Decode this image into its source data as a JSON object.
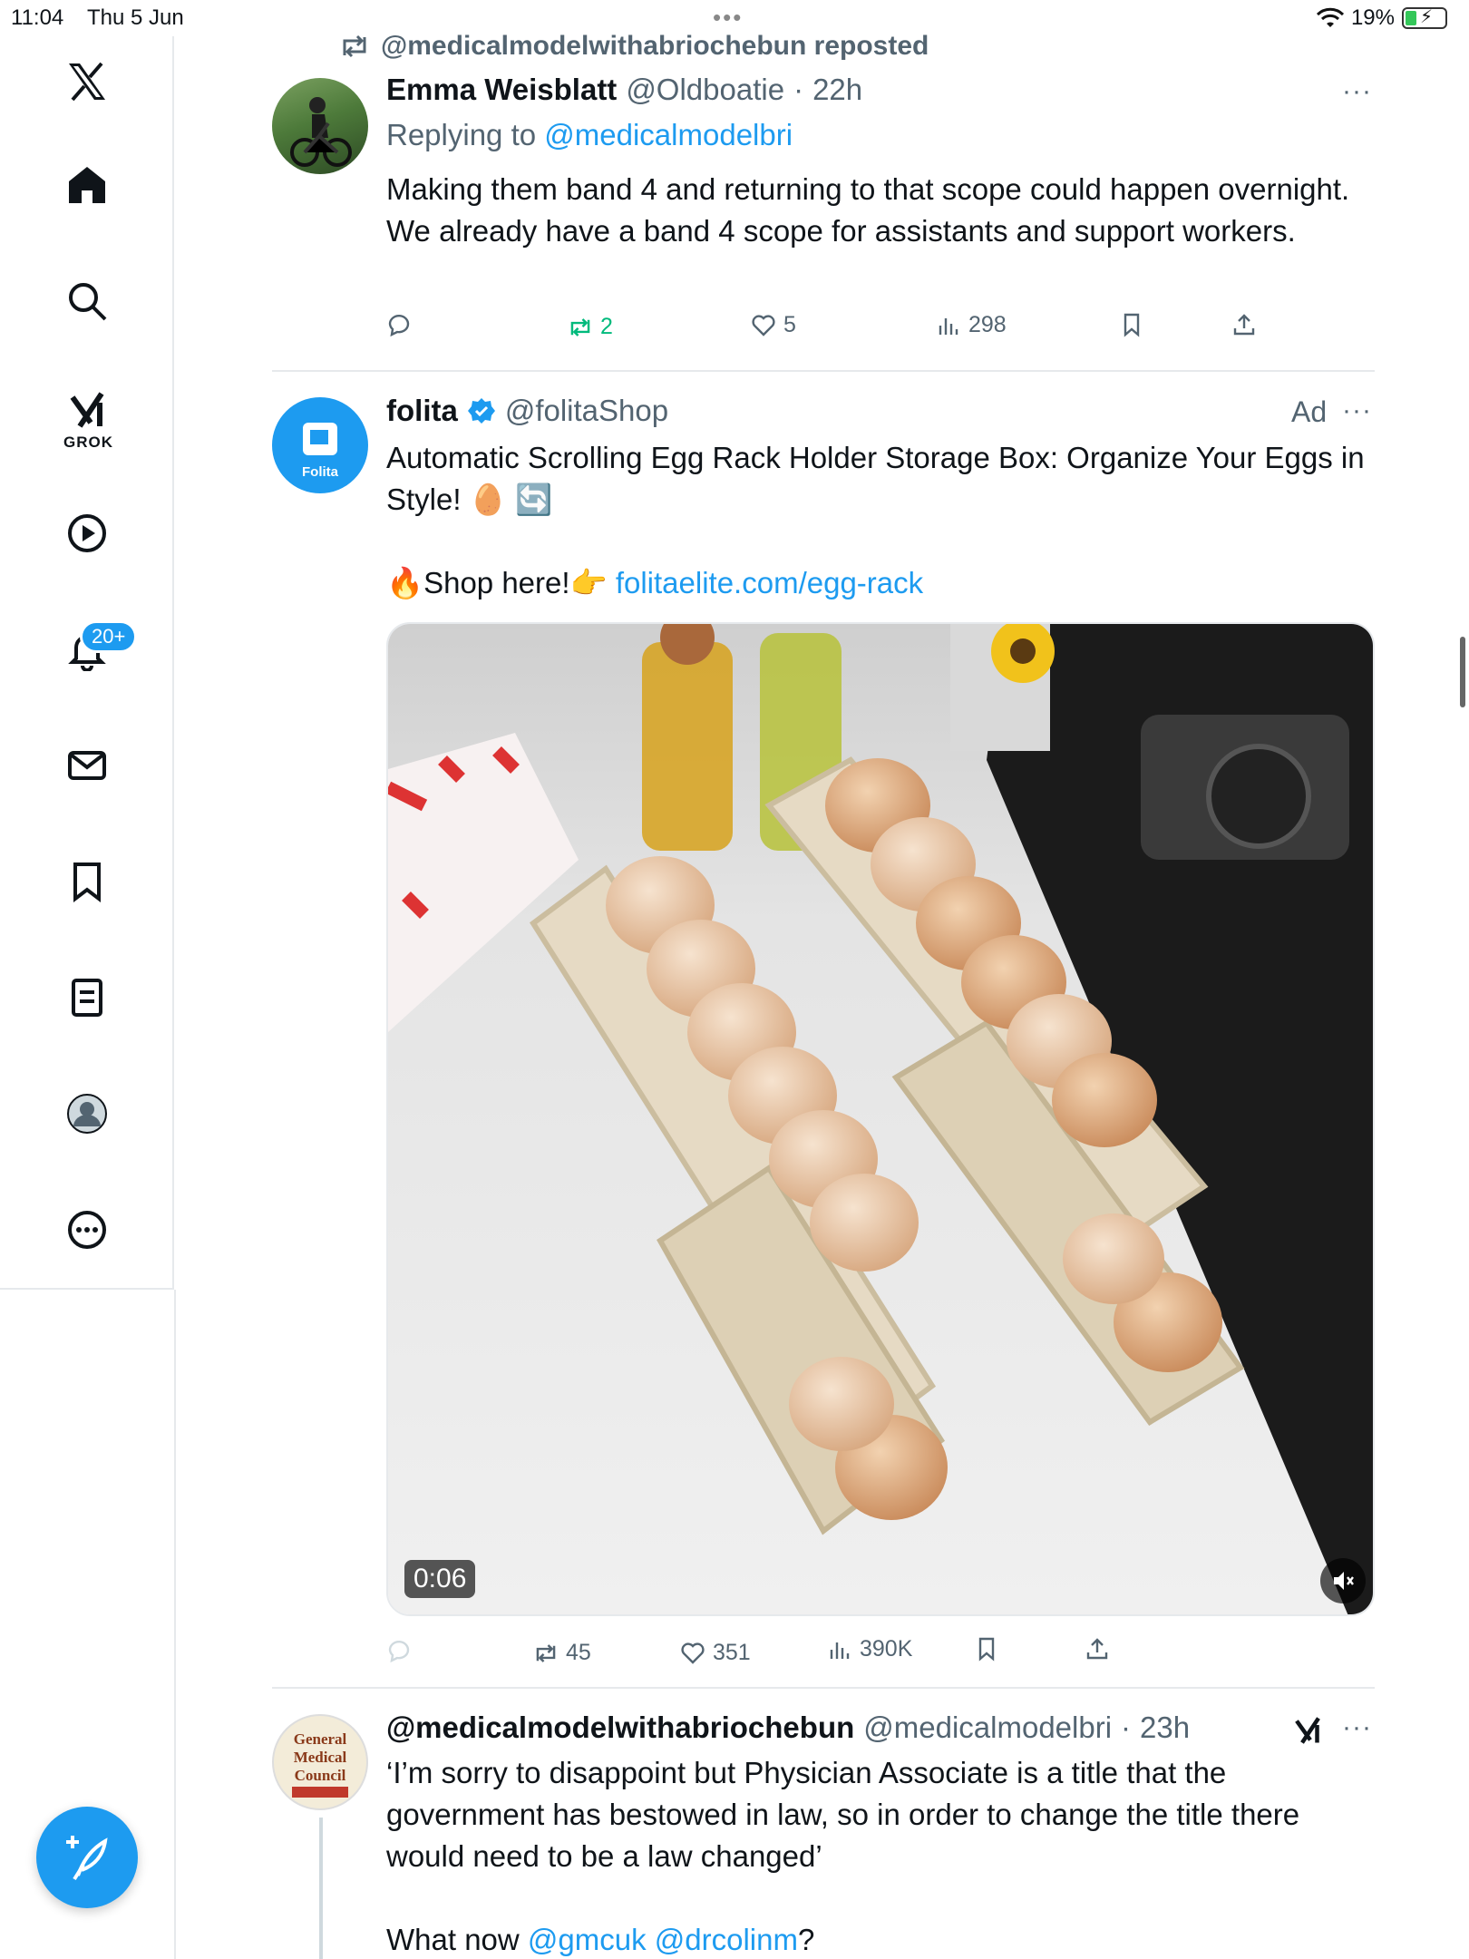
{
  "status_bar": {
    "time": "11:04",
    "date": "Thu 5 Jun",
    "battery": "19%"
  },
  "sidebar": {
    "items": [
      {
        "name": "x-logo"
      },
      {
        "name": "home"
      },
      {
        "name": "search"
      },
      {
        "name": "grok",
        "label": "GROK"
      },
      {
        "name": "video"
      },
      {
        "name": "notifications",
        "badge": "20+"
      },
      {
        "name": "messages"
      },
      {
        "name": "bookmarks"
      },
      {
        "name": "lists"
      },
      {
        "name": "profile"
      },
      {
        "name": "more"
      }
    ]
  },
  "posts": [
    {
      "repost_banner": "@medicalmodelwithabriochebun reposted",
      "name": "Emma Weisblatt",
      "handle": "@Oldboatie",
      "time": "22h",
      "replying_label": "Replying to",
      "replying_handle": "@medicalmodelbri",
      "text": "Making them band 4 and returning to that scope could happen overnight. We already have a band 4 scope for assistants and support workers.",
      "retweets": "2",
      "likes": "5",
      "views": "298"
    },
    {
      "name": "folita",
      "handle": "@folitaShop",
      "ad_label": "Ad",
      "avatar_label": "Folita",
      "text_line1": "Automatic Scrolling Egg Rack Holder Storage Box: Organize Your Eggs in Style! 🥚 🔄",
      "shop_text": "🔥Shop here!👉",
      "shop_link": "folitaelite.com/egg-rack",
      "video_time": "0:06",
      "retweets": "45",
      "likes": "351",
      "views": "390K"
    },
    {
      "name": "@medicalmodelwithabriochebun",
      "handle": "@medicalmodelbri",
      "time": "23h",
      "avatar_text": "General Medical Council",
      "text": "‘I’m sorry to disappoint but Physician Associate is a title that the government has bestowed in law, so in order to change the title there would need to be a law changed’",
      "text2_prefix": "What now",
      "mention1": "@gmcuk",
      "mention2": "@drcolinm",
      "text2_suffix": "?"
    }
  ],
  "colors": {
    "accent": "#1d9bf0",
    "retweet_green": "#00ba7c",
    "muted": "#536471"
  }
}
